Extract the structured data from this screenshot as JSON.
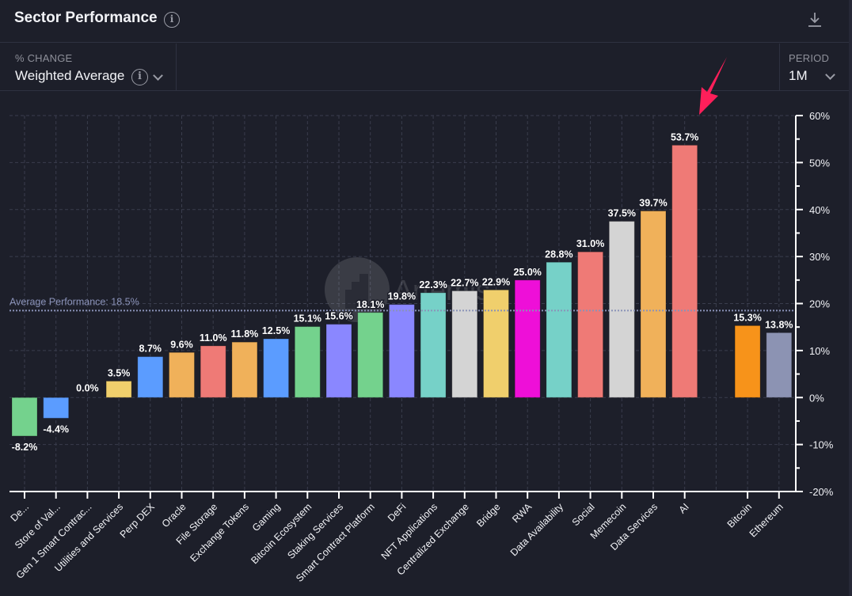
{
  "header": {
    "title": "Sector Performance",
    "info_icon": "info-icon",
    "download_icon": "download-icon"
  },
  "controls": {
    "change": {
      "label": "% CHANGE",
      "value": "Weighted Average",
      "icon": "info-icon"
    },
    "period": {
      "label": "PERIOD",
      "value": "1M"
    }
  },
  "watermark": "Artemis",
  "annotation": {
    "type": "arrow",
    "color": "#ff1f5a",
    "points_to": "AI"
  },
  "chart_data": {
    "type": "bar",
    "title": "Sector Performance",
    "xlabel": "",
    "ylabel": "",
    "ylim": [
      -20,
      60
    ],
    "y_ticks": [
      60,
      50,
      40,
      30,
      20,
      10,
      0,
      -10,
      -20
    ],
    "y_tick_labels": [
      "60%",
      "50%",
      "40%",
      "30%",
      "20%",
      "10%",
      "0%",
      "-10%",
      "-20%"
    ],
    "y_axis_position": "right",
    "grid": true,
    "reference_line": {
      "label": "Average Performance: 18.5%",
      "value": 18.5,
      "color": "#8a92b8"
    },
    "categories": [
      "De...",
      "Store of Val...",
      "Gen 1 Smart Contrac...",
      "Utilities and Services",
      "Perp DEX",
      "Oracle",
      "File Storage",
      "Exchange Tokens",
      "Gaming",
      "Bitcoin Ecosystem",
      "Staking Services",
      "Smart Contract Platform",
      "DeFi",
      "NFT Applications",
      "Centralized Exchange",
      "Bridge",
      "RWA",
      "Data Availability",
      "Social",
      "Memecoin",
      "Data Services",
      "AI",
      "Bitcoin",
      "Ethereum"
    ],
    "values": [
      -8.2,
      -4.4,
      0.0,
      3.5,
      8.7,
      9.6,
      11.0,
      11.8,
      12.5,
      15.1,
      15.6,
      18.1,
      19.8,
      22.3,
      22.7,
      22.9,
      25.0,
      28.8,
      31.0,
      37.5,
      39.7,
      53.7,
      15.3,
      13.8
    ],
    "value_labels": [
      "-8.2%",
      "-4.4%",
      "0.0%",
      "3.5%",
      "8.7%",
      "9.6%",
      "11.0%",
      "11.8%",
      "12.5%",
      "15.1%",
      "15.6%",
      "18.1%",
      "19.8%",
      "22.3%",
      "22.7%",
      "22.9%",
      "25.0%",
      "28.8%",
      "31.0%",
      "37.5%",
      "39.7%",
      "53.7%",
      "15.3%",
      "13.8%"
    ],
    "colors": [
      "#74d28d",
      "#5b9cff",
      "#f0cf6c",
      "#f0cf6c",
      "#5b9cff",
      "#f0b15a",
      "#ef7a76",
      "#f0b15a",
      "#5b9cff",
      "#74d28d",
      "#8a87ff",
      "#74d28d",
      "#8a87ff",
      "#76d1c8",
      "#d4d4d4",
      "#f0cf6c",
      "#ee0fd8",
      "#76d1c8",
      "#ef7a76",
      "#d4d4d4",
      "#f0b15a",
      "#ef7a76",
      "#f7931a",
      "#8c93b3"
    ]
  }
}
